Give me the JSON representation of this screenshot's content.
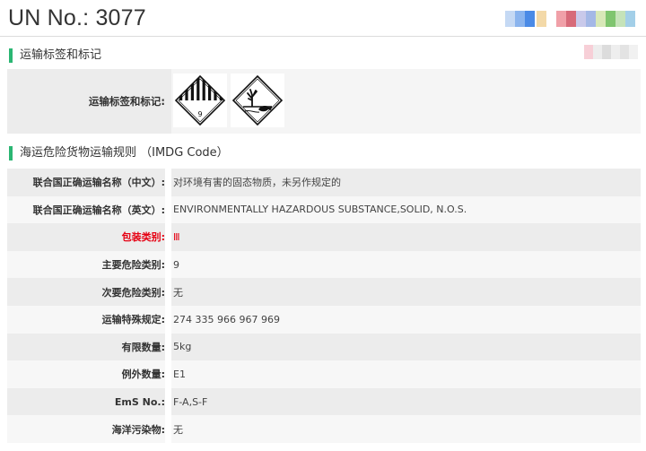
{
  "header": {
    "un_title": "UN No.: 3077"
  },
  "section_labels": {
    "title": "运输标签和标记",
    "row_label": "运输标签和标记:"
  },
  "hazard_labels": [
    {
      "icon": "class-9-miscellaneous-hazard-label",
      "number": "9"
    },
    {
      "icon": "environmentally-hazardous-substance-mark"
    }
  ],
  "section_imdg": {
    "title": "海运危险货物运输规则 （IMDG Code）"
  },
  "imdg_rows": [
    {
      "label": "联合国正确运输名称（中文）:",
      "value": "对环境有害的固态物质，未另作规定的"
    },
    {
      "label": "联合国正确运输名称（英文）:",
      "value": "ENVIRONMENTALLY HAZARDOUS SUBSTANCE,SOLID, N.O.S."
    },
    {
      "label": "包装类别:",
      "value": "Ⅲ",
      "highlight": true
    },
    {
      "label": "主要危险类别:",
      "value": "9"
    },
    {
      "label": "次要危险类别:",
      "value": "无"
    },
    {
      "label": "运输特殊规定:",
      "value": "274 335 966 967 969"
    },
    {
      "label": "有限数量:",
      "value": "5kg"
    },
    {
      "label": "例外数量:",
      "value": "E1"
    },
    {
      "label": "EmS No.:",
      "value": "F-A,S-F"
    },
    {
      "label": "海洋污染物:",
      "value": "无"
    }
  ],
  "colors": {
    "accent": "#2bb673",
    "highlight": "#e60012"
  }
}
